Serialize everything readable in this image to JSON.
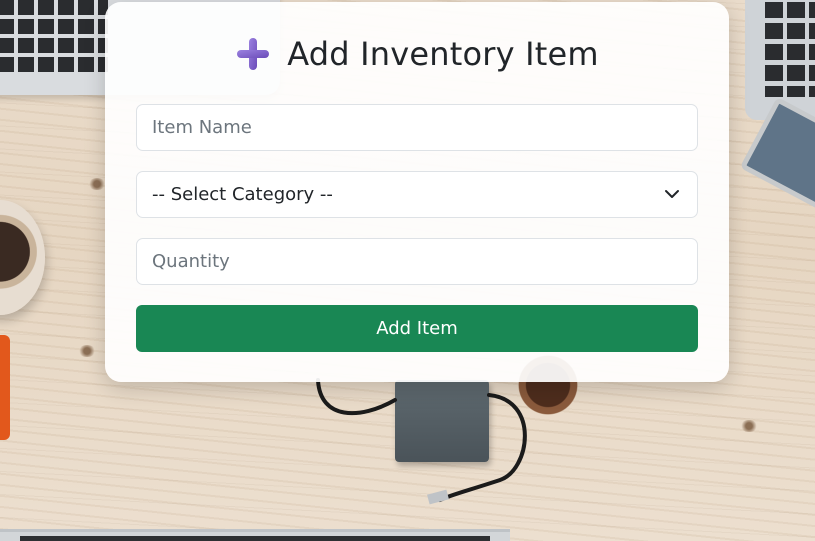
{
  "form": {
    "title": "Add Inventory Item",
    "icon": "plus-icon",
    "item_name": {
      "value": "",
      "placeholder": "Item Name"
    },
    "category": {
      "selected": "-- Select Category --"
    },
    "quantity": {
      "value": "",
      "placeholder": "Quantity"
    },
    "submit_label": "Add Item"
  },
  "colors": {
    "accent_button": "#198754",
    "icon_purple": "#7b5cc9",
    "title_text": "#212529"
  }
}
